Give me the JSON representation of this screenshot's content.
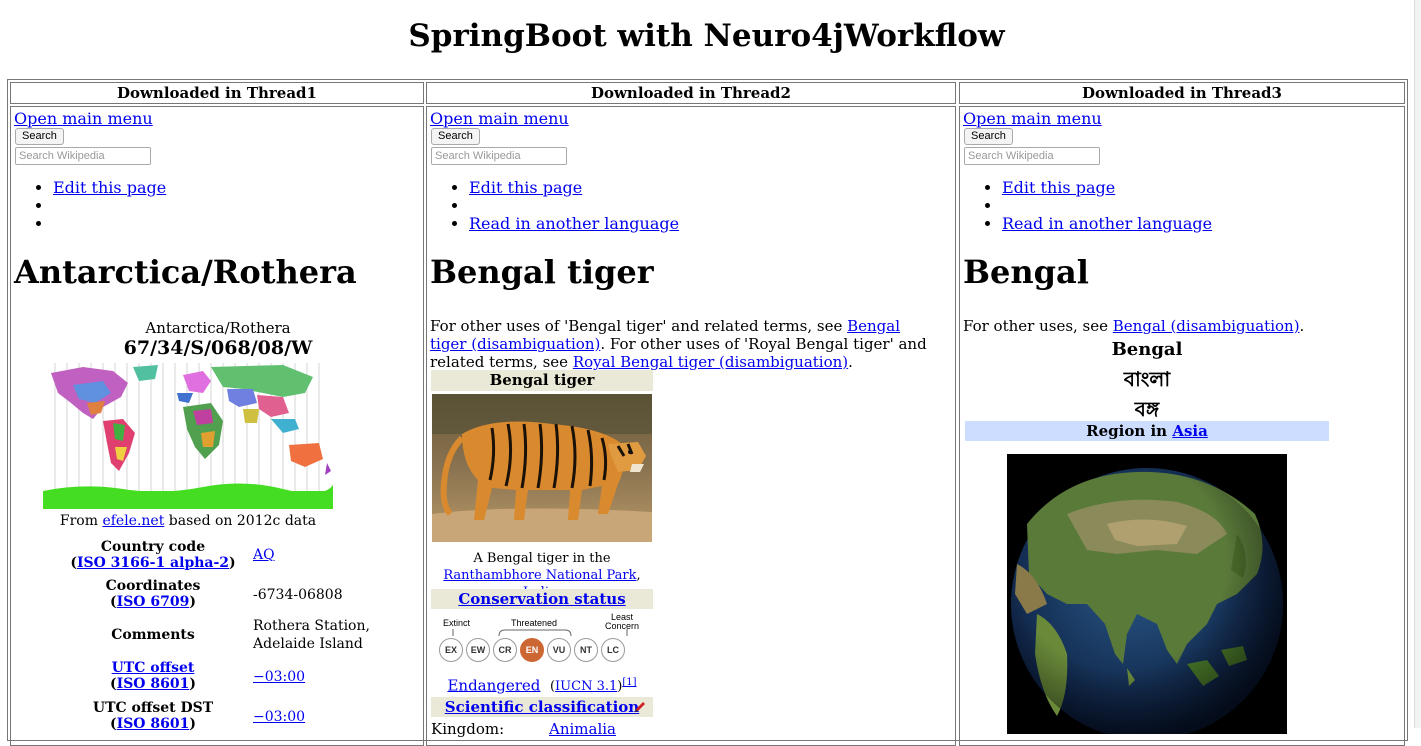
{
  "page": {
    "title": "SpringBoot with Neuro4jWorkflow"
  },
  "columns": [
    {
      "header": "Downloaded in Thread1",
      "menu_link": "Open main menu",
      "search_button": "Search",
      "search_placeholder": "Search Wikipedia",
      "bullets": [
        "Edit this page",
        "",
        ""
      ],
      "article": {
        "title": "Antarctica/Rothera",
        "subtitle": "Antarctica/Rothera",
        "coords_heading": "67/34/S/068/08/W",
        "map_caption_prefix": "From ",
        "map_caption_link": "efele.net",
        "map_caption_suffix": " based on 2012c data",
        "rows": [
          {
            "label": "Country code",
            "sub_prefix": "(",
            "sub_link": "ISO 3166-1 alpha-2",
            "sub_suffix": ")",
            "value": "AQ",
            "value_is_link": true
          },
          {
            "label": "Coordinates",
            "sub_prefix": "(",
            "sub_link": "ISO 6709",
            "sub_suffix": ")",
            "value": "-6734-06808",
            "value_is_link": false
          },
          {
            "label": "Comments",
            "value_line1": "Rothera Station,",
            "value_line2": "Adelaide Island"
          },
          {
            "label_link": "UTC offset",
            "sub_prefix": "(",
            "sub_link": "ISO 8601",
            "sub_suffix": ")",
            "value": "−03:00",
            "value_is_link": true
          },
          {
            "label": "UTC offset DST",
            "sub_prefix": "(",
            "sub_link": "ISO 8601",
            "sub_suffix": ")",
            "value": "−03:00",
            "value_is_link": true
          }
        ]
      }
    },
    {
      "header": "Downloaded in Thread2",
      "menu_link": "Open main menu",
      "search_button": "Search",
      "search_placeholder": "Search Wikipedia",
      "bullets": [
        "Edit this page",
        "",
        "Read in another language"
      ],
      "article": {
        "title": "Bengal tiger",
        "hatnote": {
          "t1": "For other uses of 'Bengal tiger' and related terms, see ",
          "l1": "Bengal tiger (disambiguation)",
          "t2": ". For other uses of 'Royal Bengal tiger' and related terms, see ",
          "l2": "Royal Bengal tiger (disambiguation)",
          "t3": "."
        },
        "infobox_title": "Bengal tiger",
        "caption": {
          "t1": "A Bengal tiger in the ",
          "l1": "Ranthambhore National Park",
          "t2": ", ",
          "l2": "India",
          "t3": "."
        },
        "conservation_heading": "Conservation status",
        "status_labels": {
          "extinct": "Extinct",
          "threatened": "Threatened",
          "least": "Least",
          "concern": "Concern"
        },
        "chips": [
          "EX",
          "EW",
          "CR",
          "EN",
          "VU",
          "NT",
          "LC"
        ],
        "status_link": "Endangered",
        "status_ref_prefix": "(",
        "status_ref_link": "IUCN 3.1",
        "status_ref_suffix": ")",
        "status_sup": "[1]",
        "classification_heading": "Scientific classification",
        "kingdom_label": "Kingdom:",
        "kingdom_value": "Animalia"
      }
    },
    {
      "header": "Downloaded in Thread3",
      "menu_link": "Open main menu",
      "search_button": "Search",
      "search_placeholder": "Search Wikipedia",
      "bullets": [
        "Edit this page",
        "",
        "Read in another language"
      ],
      "article": {
        "title": "Bengal",
        "hatnote_text": "For other uses, see ",
        "hatnote_link": "Bengal (disambiguation)",
        "hatnote_end": ".",
        "name_en": "Bengal",
        "name_bn1": "বাংলা",
        "name_bn2": "বঙ্গ",
        "region_prefix": "Region in ",
        "region_link": "Asia"
      }
    }
  ],
  "colors": {
    "link": "#0000ee",
    "infobox_header": "#eae8d6",
    "region_header": "#ccddff",
    "status_active": "#cc6633"
  }
}
